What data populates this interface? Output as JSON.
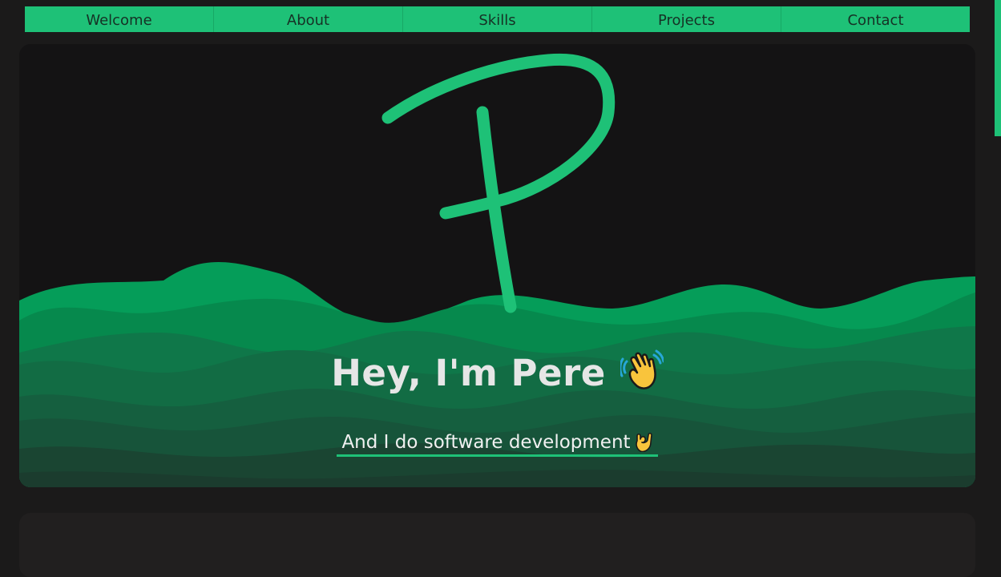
{
  "nav": {
    "items": [
      {
        "label": "Welcome"
      },
      {
        "label": "About"
      },
      {
        "label": "Skills"
      },
      {
        "label": "Projects"
      },
      {
        "label": "Contact"
      }
    ]
  },
  "hero": {
    "logo_icon": "handwritten-p-logo",
    "title": "Hey, I'm Pere",
    "title_emoji_icon": "waving-hand-emoji",
    "subtitle": "And I do software development",
    "subtitle_emoji_icon": "ok-hand-emoji"
  },
  "colors": {
    "accent": "#1ec177",
    "background": "#1b1a1a",
    "hero_background": "#141314",
    "text": "#e6e6e6"
  }
}
